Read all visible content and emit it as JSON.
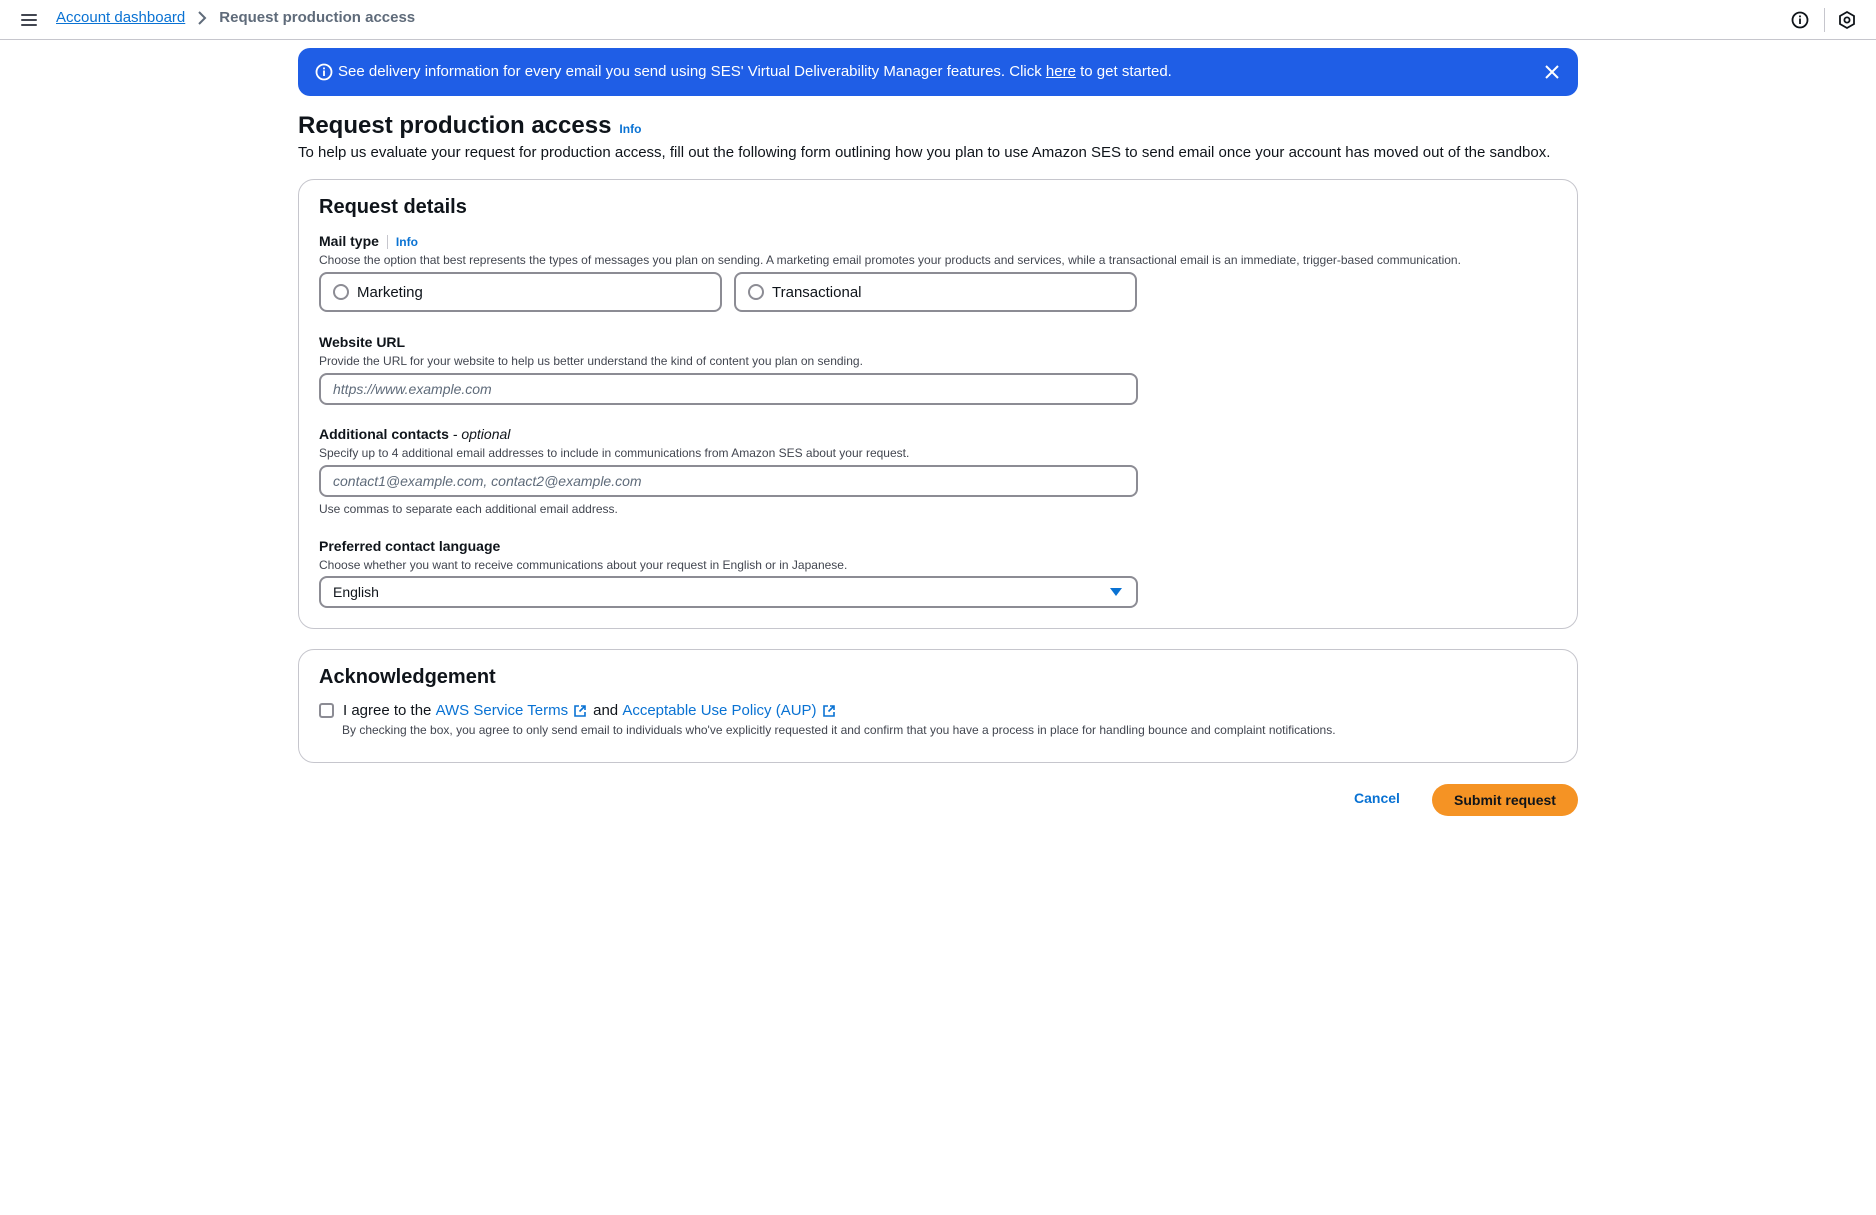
{
  "topbar": {
    "breadcrumb": {
      "parent": "Account dashboard",
      "current": "Request production access"
    },
    "icons": [
      "menu-icon",
      "chevron-right-icon",
      "info-icon",
      "settings-icon"
    ]
  },
  "banner": {
    "text_before": "See delivery information for every email you send using SES' Virtual Deliverability Manager features. Click ",
    "link": "here",
    "text_after": " to get started.",
    "color": "#1f5ee6"
  },
  "page": {
    "title": "Request production access",
    "info": "Info",
    "description": "To help us evaluate your request for production access, fill out the following form outlining how you plan to use Amazon SES to send email once your account has moved out of the sandbox."
  },
  "request_details": {
    "header": "Request details",
    "mail_type": {
      "label": "Mail type",
      "info": "Info",
      "description": "Choose the option that best represents the types of messages you plan on sending. A marketing email promotes your products and services, while a transactional email is an immediate, trigger-based communication.",
      "options": [
        "Marketing",
        "Transactional"
      ]
    },
    "website_url": {
      "label": "Website URL",
      "description": "Provide the URL for your website to help us better understand the kind of content you plan on sending.",
      "placeholder": "https://www.example.com"
    },
    "additional_contacts": {
      "label": "Additional contacts",
      "optional": "- optional",
      "description": "Specify up to 4 additional email addresses to include in communications from Amazon SES about your request.",
      "placeholder": "contact1@example.com, contact2@example.com",
      "constraint": "Use commas to separate each additional email address."
    },
    "preferred_language": {
      "label": "Preferred contact language",
      "description": "Choose whether you want to receive communications about your request in English or in Japanese.",
      "value": "English"
    }
  },
  "acknowledgement": {
    "header": "Acknowledgement",
    "agree_prefix": "I agree to the",
    "terms_link": "AWS Service Terms",
    "and": "and",
    "aup_link": "Acceptable Use Policy (AUP)",
    "description": "By checking the box, you agree to only send email to individuals who've explicitly requested it and confirm that you have a process in place for handling bounce and complaint notifications."
  },
  "actions": {
    "cancel": "Cancel",
    "submit": "Submit request",
    "submit_color": "#f59324",
    "link_color": "#0972d3"
  }
}
